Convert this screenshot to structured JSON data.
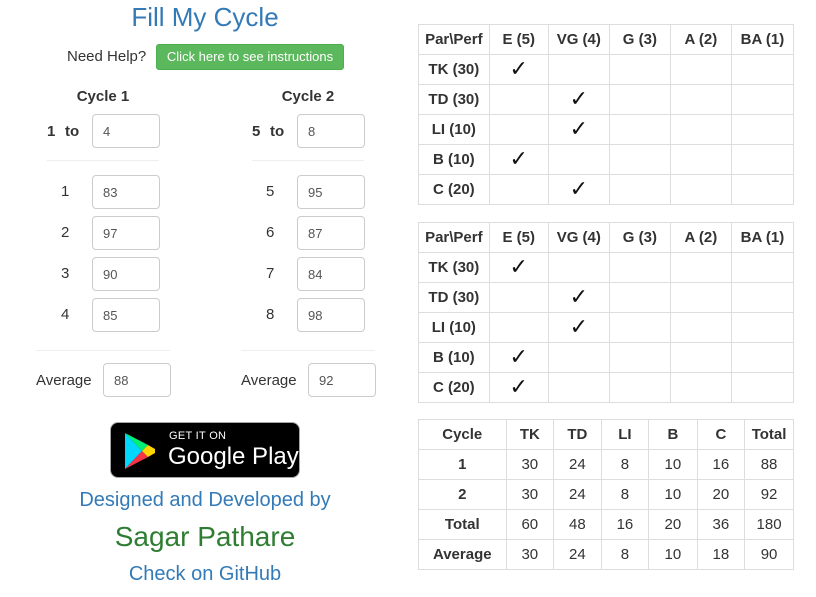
{
  "title": "Fill My Cycle",
  "help": {
    "label": "Need Help?",
    "button": "Click here to see instructions"
  },
  "cycle1": {
    "heading": "Cycle 1",
    "range_start": "1",
    "range_to": "to",
    "range_end": "4",
    "rows": [
      {
        "n": "1",
        "v": "83"
      },
      {
        "n": "2",
        "v": "97"
      },
      {
        "n": "3",
        "v": "90"
      },
      {
        "n": "4",
        "v": "85"
      }
    ],
    "average_label": "Average",
    "average_value": "88"
  },
  "cycle2": {
    "heading": "Cycle 2",
    "range_start": "5",
    "range_to": "to",
    "range_end": "8",
    "rows": [
      {
        "n": "5",
        "v": "95"
      },
      {
        "n": "6",
        "v": "87"
      },
      {
        "n": "7",
        "v": "84"
      },
      {
        "n": "8",
        "v": "98"
      }
    ],
    "average_label": "Average",
    "average_value": "92"
  },
  "perf_headers": [
    "Par\\Perf",
    "E (5)",
    "VG (4)",
    "G (3)",
    "A (2)",
    "BA (1)"
  ],
  "perf_table1": [
    {
      "param": "TK (30)",
      "check": 1
    },
    {
      "param": "TD (30)",
      "check": 2
    },
    {
      "param": "LI (10)",
      "check": 2
    },
    {
      "param": "B (10)",
      "check": 1
    },
    {
      "param": "C (20)",
      "check": 2
    }
  ],
  "perf_table2": [
    {
      "param": "TK (30)",
      "check": 1
    },
    {
      "param": "TD (30)",
      "check": 2
    },
    {
      "param": "LI (10)",
      "check": 2
    },
    {
      "param": "B (10)",
      "check": 1
    },
    {
      "param": "C (20)",
      "check": 1
    }
  ],
  "check_mark": "✓",
  "summary": {
    "headers": [
      "Cycle",
      "TK",
      "TD",
      "LI",
      "B",
      "C",
      "Total"
    ],
    "rows": [
      [
        "1",
        "30",
        "24",
        "8",
        "10",
        "16",
        "88"
      ],
      [
        "2",
        "30",
        "24",
        "8",
        "10",
        "20",
        "92"
      ],
      [
        "Total",
        "60",
        "48",
        "16",
        "20",
        "36",
        "180"
      ],
      [
        "Average",
        "30",
        "24",
        "8",
        "10",
        "18",
        "90"
      ]
    ]
  },
  "play_badge": {
    "top_text": "GET IT ON",
    "name": "Google Play"
  },
  "credits": {
    "designed": "Designed and Developed by",
    "author": "Sagar Pathare",
    "github": "Check on GitHub"
  },
  "colors": {
    "link": "#337ab7",
    "help_button": "#5cb85c",
    "author": "#2e7d32"
  }
}
